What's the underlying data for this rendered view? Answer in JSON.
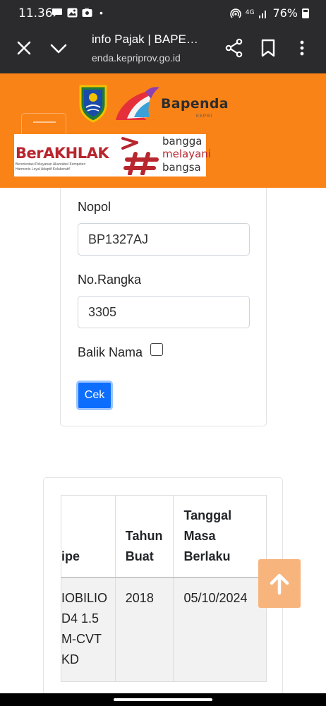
{
  "status_bar": {
    "time": "11.36",
    "dot": "•",
    "network": "4G",
    "battery": "76%"
  },
  "browser": {
    "title": "info Pajak | BAPE…",
    "url": "enda.kepriprov.go.id"
  },
  "header": {
    "brand_name": "Bapenda",
    "brand_sub": "KEPRI",
    "banner": {
      "berakhlak": "BerAKHLAK",
      "tagline_1": "Berorientasi Pelayanan Akuntabel Kompeten",
      "tagline_2": "Harmonis Loyal Adaptif Kolaboratif",
      "line_1": "bangga",
      "line_2": "melayani",
      "line_3": "bangsa"
    }
  },
  "form": {
    "nopol_label": "Nopol",
    "nopol_value": "BP1327AJ",
    "rangka_label": "No.Rangka",
    "rangka_value": "3305",
    "balik_nama_label": "Balik Nama",
    "cek_label": "Cek"
  },
  "result_table": {
    "headers": {
      "tipe": "ipe",
      "tahun_buat_1": "Tahun",
      "tahun_buat_2": "Buat",
      "tanggal_1": "Tanggal",
      "tanggal_2": "Masa",
      "tanggal_3": "Berlaku"
    },
    "row": {
      "tipe_1": "IOBILIO",
      "tipe_2": "D4 1.5",
      "tipe_3": "M-CVT",
      "tipe_4": "KD",
      "tahun_buat": "2018",
      "tanggal_masa_berlaku": "05/10/2024"
    }
  },
  "colors": {
    "header_orange": "#f98317",
    "browser_dark": "#2b2b2d",
    "button_blue": "#0d6efd",
    "brand_red": "#b8262e"
  },
  "icons": [
    "chat-icon",
    "image-icon",
    "media-icon",
    "hotspot-icon",
    "signal-icon",
    "battery-icon",
    "close-icon",
    "chevron-down-icon",
    "share-icon",
    "bookmark-icon",
    "more-vert-icon",
    "arrow-up-icon"
  ]
}
